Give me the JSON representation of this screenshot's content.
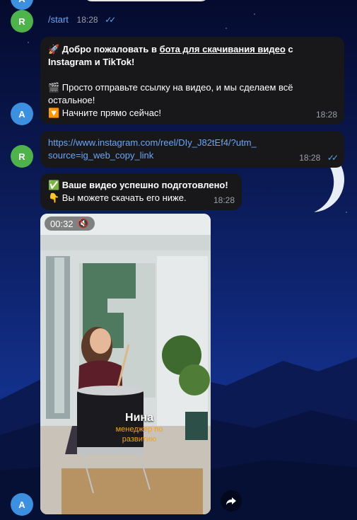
{
  "avatars": {
    "user": "R",
    "bot": "A"
  },
  "messages": {
    "start": {
      "text": "/start",
      "time": "18:28"
    },
    "welcome": {
      "line1_prefix": "🚀 Добро пожаловать в ",
      "line1_link": "бота для скачивания видео",
      "line1_suffix": " с Instagram и TikTok!",
      "line2": "🎬 Просто отправьте ссылку на видео, и мы сделаем всё остальное!",
      "line3": "🔽 Начните прямо сейчас!",
      "time": "18:28"
    },
    "link": {
      "url": "https://www.instagram.com/reel/DIy_J82tEf4/?utm_source=ig_web_copy_link",
      "time": "18:28"
    },
    "ready": {
      "title": "✅ Ваше видео успешно подготовлено!",
      "subtitle": "👇 Вы можете скачать его ниже.",
      "time": "18:28"
    }
  },
  "video": {
    "duration": "00:32",
    "caption_name": "Нина",
    "caption_role": "менеджер по развитию"
  },
  "icons": {
    "mute": "speaker-muted-icon",
    "share": "share-icon",
    "read": "double-check-icon"
  },
  "colors": {
    "bubble": "#18181b",
    "link": "#6aa6f7",
    "check": "#5aa7e8",
    "caption_role": "#f2a21d"
  }
}
